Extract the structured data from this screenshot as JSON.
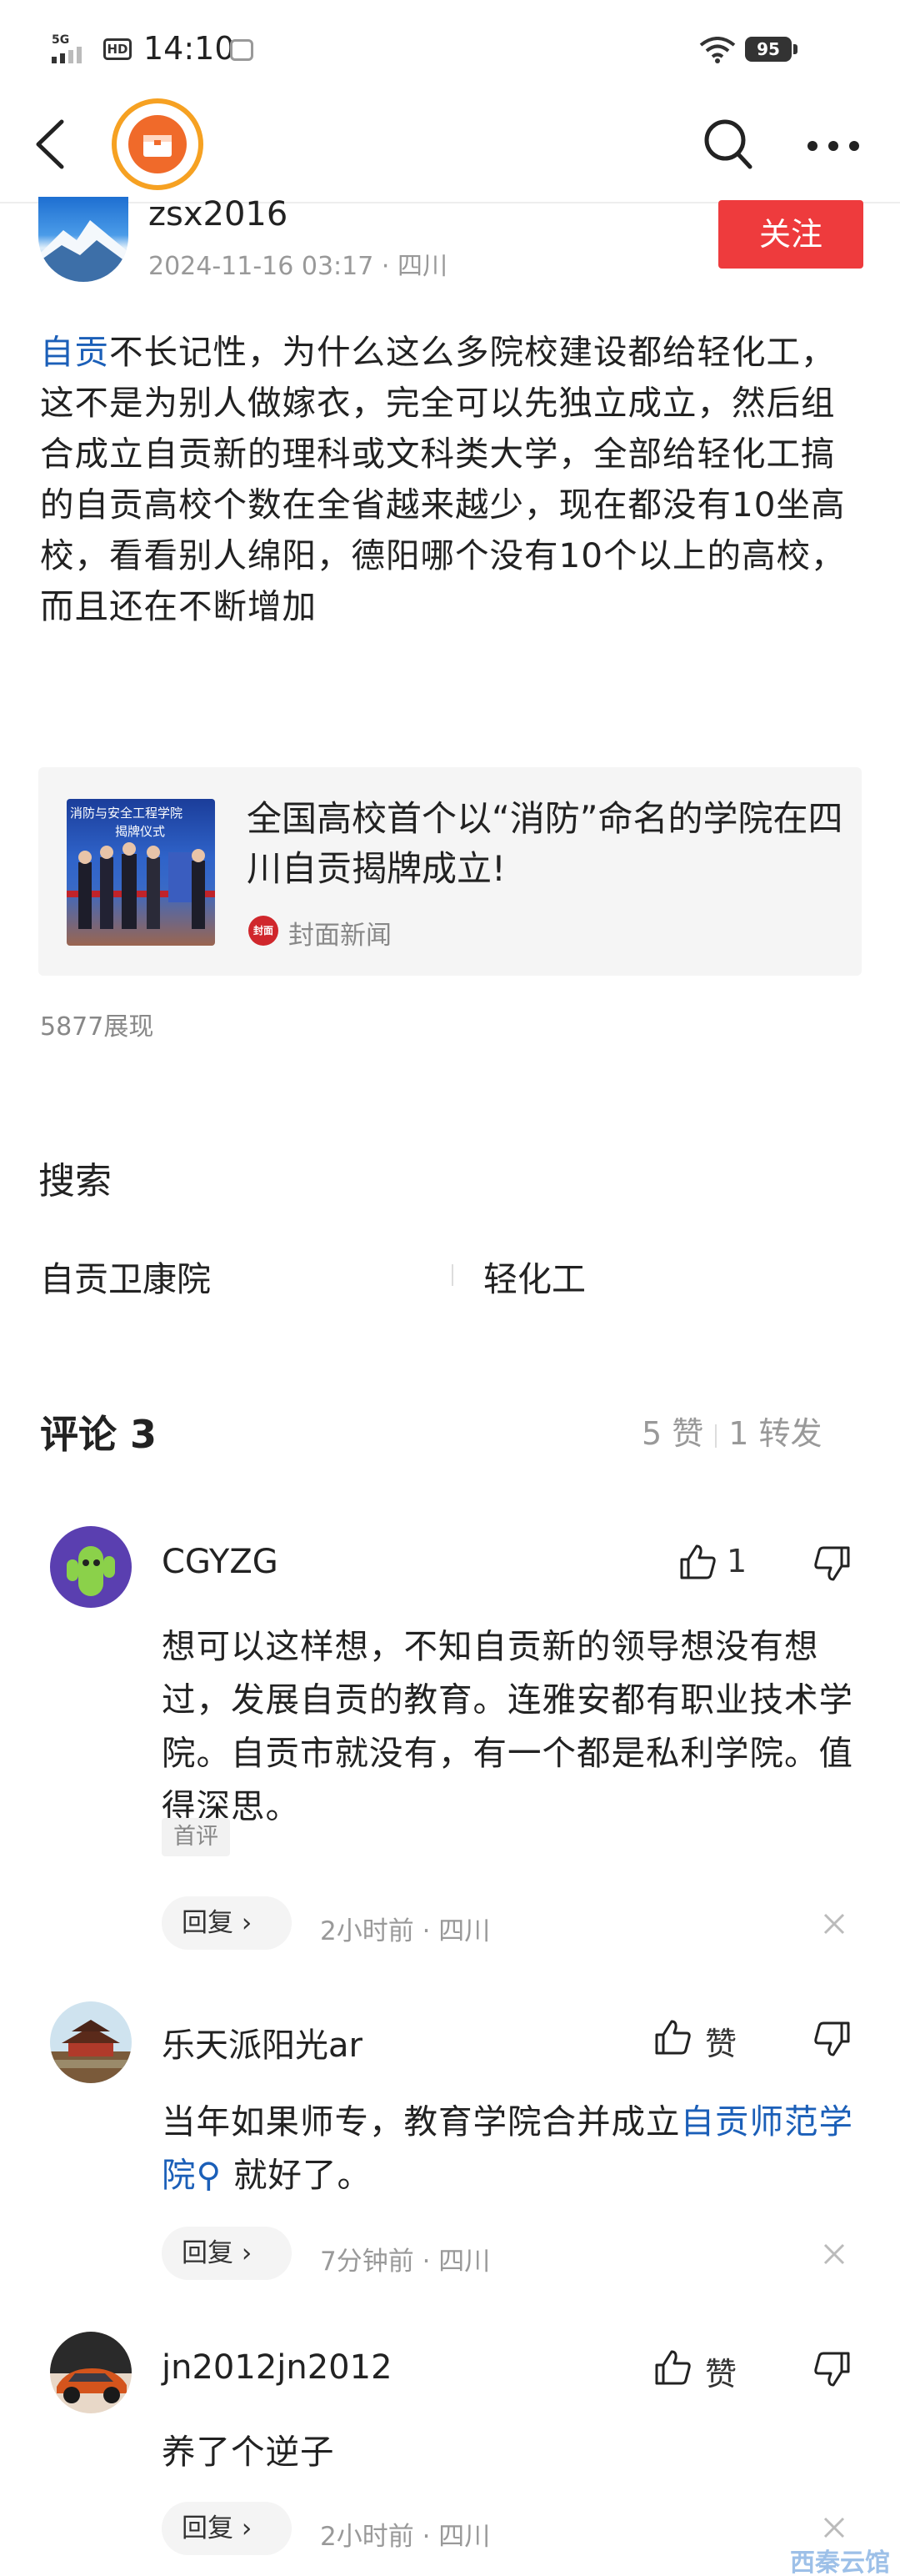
{
  "status_bar": {
    "time": "14:10",
    "network": "5G",
    "hd_label": "HD",
    "battery": "95"
  },
  "nav": {
    "back_icon": "back-arrow-icon",
    "search_icon": "search-icon",
    "more_icon": "more-icon"
  },
  "author": {
    "name": "zsx2016",
    "meta": "2024-11-16 03:17 · 四川",
    "follow_label": "关注"
  },
  "post": {
    "hashtag": "自贡",
    "text": "不长记性，为什么这么多院校建设都给轻化工，这不是为别人做嫁衣，完全可以先独立成立，然后组合成立自贡新的理科或文科类大学，全部给轻化工搞的自贡高校个数在全省越来越少，现在都没有10坐高校，看看别人绵阳，德阳哪个没有10个以上的高校，而且还在不断增加"
  },
  "link_card": {
    "title": "全国高校首个以“消防”命名的学院在四川自贡揭牌成立!",
    "source": "封面新闻",
    "source_logo": "封面",
    "thumb_text_1": "消防与安全工程学院",
    "thumb_text_2": "揭牌仪式"
  },
  "views": "5877展现",
  "search": {
    "title": "搜索",
    "items": [
      "自贡卫康院",
      "轻化工"
    ]
  },
  "comments_header": {
    "title": "评论 3",
    "likes": "5 赞",
    "reposts": "1 转发"
  },
  "comments": [
    {
      "name": "CGYZG",
      "like_label": "1",
      "text": "想可以这样想，不知自贡新的领导想没有想过，发展自贡的教育。连雅安都有职业技术学院。自贡市就没有，有一个都是私利学院。值得深思。",
      "badge": "首评",
      "reply_label": "回复",
      "time": "2小时前",
      "location": "四川"
    },
    {
      "name": "乐天派阳光ar",
      "like_label": "赞",
      "text_before": "当年如果师专，教育学院合并成立",
      "text_link": "自贡师范学院",
      "text_after": " 就好了。",
      "reply_label": "回复",
      "time": "7分钟前",
      "location": "四川"
    },
    {
      "name": "jn2012jn2012",
      "like_label": "赞",
      "text": "养了个逆子",
      "reply_label": "回复",
      "time": "2小时前",
      "location": "四川"
    }
  ],
  "watermark": "西秦云馆"
}
